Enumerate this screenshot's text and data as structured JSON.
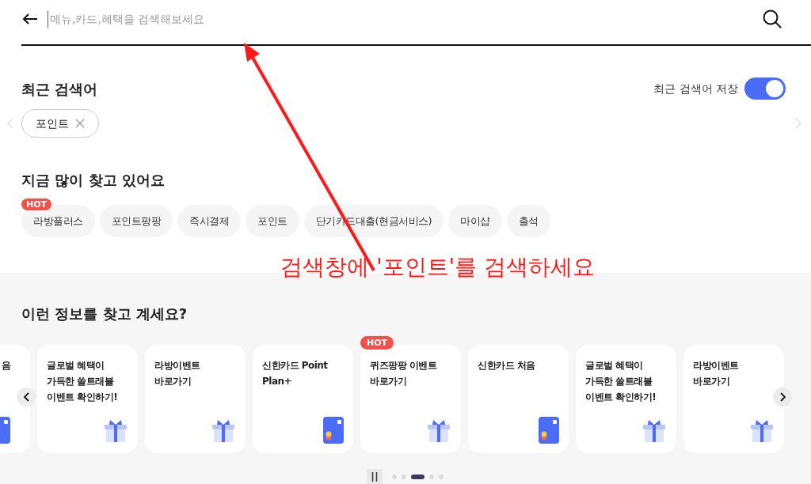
{
  "search": {
    "placeholder": "메뉴,카드,혜택을 검색해보세요"
  },
  "recent": {
    "title": "최근 검색어",
    "save_label": "최근 검색어 저장",
    "save_on": true,
    "terms": [
      {
        "label": "포인트"
      }
    ]
  },
  "popular": {
    "title": "지금 많이 찾고 있어요",
    "hot_label": "HOT",
    "chips": [
      {
        "label": "라방플러스",
        "hot": true
      },
      {
        "label": "포인트팡팡",
        "hot": false
      },
      {
        "label": "즉시결제",
        "hot": false
      },
      {
        "label": "포인트",
        "hot": false
      },
      {
        "label": "단기카드대출(현금서비스)",
        "hot": false
      },
      {
        "label": "마이샵",
        "hot": false
      },
      {
        "label": "출석",
        "hot": false
      }
    ]
  },
  "suggest": {
    "title": "이런 정보를 찾고 계세요?",
    "hot_label": "HOT",
    "cards": [
      {
        "title": "음",
        "kind": "card",
        "hot": false,
        "clipped": true
      },
      {
        "title": "글로벌 혜택이 가득한 쏠트래블 이벤트 확인하기!",
        "kind": "gift",
        "hot": false
      },
      {
        "title": "라방이벤트 바로가기",
        "kind": "gift",
        "hot": false
      },
      {
        "title": "신한카드 Point Plan+",
        "kind": "card",
        "hot": false
      },
      {
        "title": "퀴즈팡팡 이벤트 바로가기",
        "kind": "gift",
        "hot": true
      },
      {
        "title": "신한카드 처음",
        "kind": "card",
        "hot": false
      },
      {
        "title": "글로벌 혜택이 가득한 쏠트래블 이벤트 확인하기!",
        "kind": "gift",
        "hot": false
      },
      {
        "title": "라방이벤트 바로가기",
        "kind": "gift",
        "hot": false
      }
    ],
    "pages": [
      {
        "selected": false
      },
      {
        "selected": false
      },
      {
        "selected": true
      },
      {
        "selected": false
      },
      {
        "selected": false
      }
    ]
  },
  "annotation": {
    "text": "검색창에 '포인트'를 검색하세요"
  }
}
